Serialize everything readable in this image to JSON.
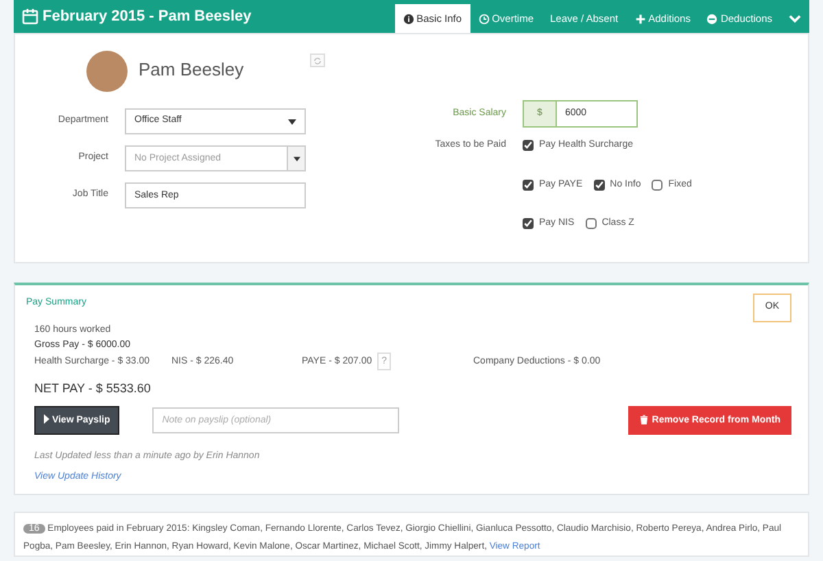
{
  "header": {
    "title": "February 2015 - Pam Beesley",
    "tabs": [
      {
        "label": "Basic Info",
        "selected": true
      },
      {
        "label": "Overtime",
        "selected": false
      },
      {
        "label": "Leave / Absent",
        "selected": false
      },
      {
        "label": "Additions",
        "selected": false
      },
      {
        "label": "Deductions",
        "selected": false
      }
    ]
  },
  "profile": {
    "name": "Pam Beesley",
    "fields": [
      {
        "label": "Department",
        "kind": "select",
        "value": "Office Staff"
      },
      {
        "label": "Project",
        "kind": "combo",
        "placeholder": "No Project Assigned"
      },
      {
        "label": "Job Title",
        "kind": "text",
        "value": "Sales Rep"
      }
    ]
  },
  "salary": {
    "label": "Basic Salary",
    "prefix": "$",
    "value": "6000"
  },
  "taxes": {
    "label": "Taxes to be Paid",
    "rows": [
      [
        {
          "label": "Pay Health Surcharge",
          "checked": true
        }
      ],
      [
        {
          "label": "Pay PAYE",
          "checked": true
        },
        {
          "label": "No Info",
          "checked": true
        },
        {
          "label": "Fixed",
          "checked": false
        }
      ],
      [
        {
          "label": "Pay NIS",
          "checked": true
        },
        {
          "label": "Class Z",
          "checked": false
        }
      ]
    ]
  },
  "pay_summary": {
    "title": "Pay Summary",
    "ok_button": "OK",
    "hours": "160 hours worked",
    "gross": "Gross Pay - $ 6000.00",
    "deductions": [
      {
        "text": "Health Surcharge - $ 33.00"
      },
      {
        "text": "NIS - $ 226.40"
      },
      {
        "text": "PAYE - $ 207.00",
        "help": "?"
      },
      {
        "text": "Company Deductions - $ 0.00"
      }
    ],
    "net": "NET PAY - $ 5533.60",
    "view_button": "View Payslip",
    "note_placeholder": "Note on payslip (optional)",
    "remove_button": "Remove Record from Month",
    "updated": "Last Updated less than a minute ago by Erin Hannon",
    "history_link": "View Update History"
  },
  "footer": {
    "count": "16",
    "text": "Employees paid in February 2015: Kingsley Coman, Fernando Llorente, Carlos Tevez, Giorgio Chiellini, Gianluca Pessotto, Claudio Marchisio, Roberto Pereya, Andrea Pirlo, Paul Pogba, Pam Beesley, Erin Hannon, Ryan Howard, Kevin Malone, Oscar Martinez, Michael Scott, Jimmy Halpert,",
    "link": "View Report"
  }
}
